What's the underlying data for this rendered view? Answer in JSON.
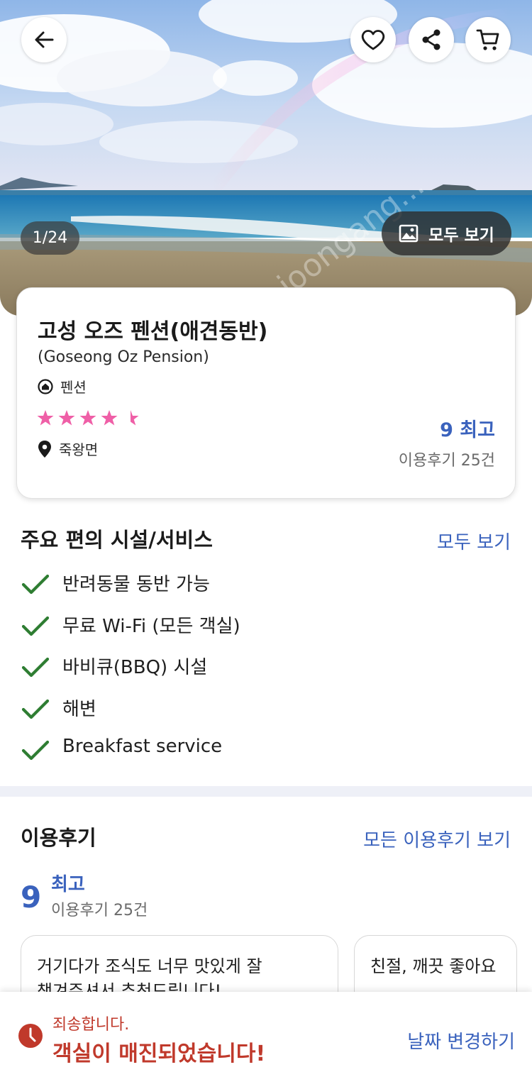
{
  "hero": {
    "photo_counter": "1/24",
    "view_all_photos": "모두 보기",
    "icons": {
      "back": "back-arrow-icon",
      "favorite": "heart-icon",
      "share": "share-icon",
      "cart": "cart-icon",
      "photos": "image-icon"
    },
    "watermark": "www.joongang..."
  },
  "property": {
    "name": "고성 오즈 펜션(애견동반)",
    "english_name": "(Goseong Oz Pension)",
    "type": "펜션",
    "star_rating": 4.5,
    "location": "죽왕면",
    "score": "9 최고",
    "review_count": "이용후기 25건"
  },
  "amenities": {
    "title": "주요 편의 시설/서비스",
    "view_all": "모두 보기",
    "items": [
      "반려동물 동반 가능",
      "무료 Wi-Fi (모든 객실)",
      "바비큐(BBQ) 시설",
      "해변",
      "Breakfast service"
    ]
  },
  "reviews": {
    "title": "이용후기",
    "view_all": "모든 이용후기 보기",
    "score": "9",
    "label": "최고",
    "count": "이용후기 25건",
    "cards": [
      {
        "line1": "거기다가 조식도 너무 맛있게 잘",
        "line2": "챙겨주셔서 추천드립니다!"
      },
      {
        "line1": "친절, 깨끗 좋아요",
        "line2": ""
      }
    ]
  },
  "bottom_bar": {
    "sorry": "죄송합니다.",
    "sold_out": "객실이 매진되었습니다!",
    "change_date": "날짜 변경하기"
  },
  "colors": {
    "accent": "#3a62bd",
    "check": "#2e7d32",
    "star": "#ef5fa7",
    "alert": "#c0392b",
    "divider": "#eef0f7"
  }
}
